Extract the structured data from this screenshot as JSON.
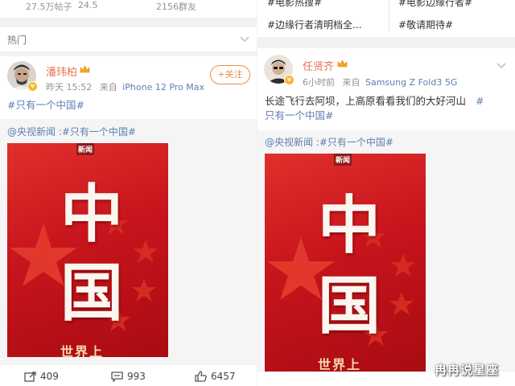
{
  "left": {
    "stats": [
      "27.5万帖子",
      "24.5",
      "2156群友"
    ],
    "section_title": "热门",
    "post": {
      "username": "潘玮柏",
      "time": "昨天 15:52",
      "source_prefix": "来自",
      "source": "iPhone 12 Pro Max",
      "follow_label": "+关注",
      "text": "#只有一个中国#",
      "repost_text": "@央视新闻 :#只有一个中国#",
      "image": {
        "logo": "新闻",
        "char1": "中",
        "char2": "国",
        "bottom_text": "世界上"
      },
      "actions": {
        "repost_count": "409",
        "comment_count": "993",
        "like_count": "6457"
      }
    }
  },
  "right": {
    "topics": [
      "#电影热搜#",
      "#电影边缘行者#",
      "#边缘行者清明档全...",
      "#敬请期待#"
    ],
    "post": {
      "username": "任贤齐",
      "time": "6小时前",
      "source_prefix": "来自",
      "source": "Samsung Z Fold3 5G",
      "text_line1": "长途飞行去阿坝，上高原看看我们的大好河山",
      "tag_part1": "#",
      "tag_part2": "只有一个中国#",
      "repost_text": "@央视新闻 :#只有一个中国#",
      "image": {
        "logo": "新闻",
        "char1": "中",
        "char2": "国",
        "bottom_text": "世界上"
      }
    }
  },
  "watermark": "冉冉说星座",
  "colors": {
    "username": "#eb7350",
    "link": "#5d7fb5",
    "follow": "#f28c47",
    "poster_red": "#c8141c",
    "gap": "#f2f2f2"
  },
  "icons": [
    "crown-badge-icon",
    "verified-icon",
    "chevron-down-icon",
    "repost-icon",
    "comment-icon",
    "like-icon",
    "star-icon"
  ]
}
